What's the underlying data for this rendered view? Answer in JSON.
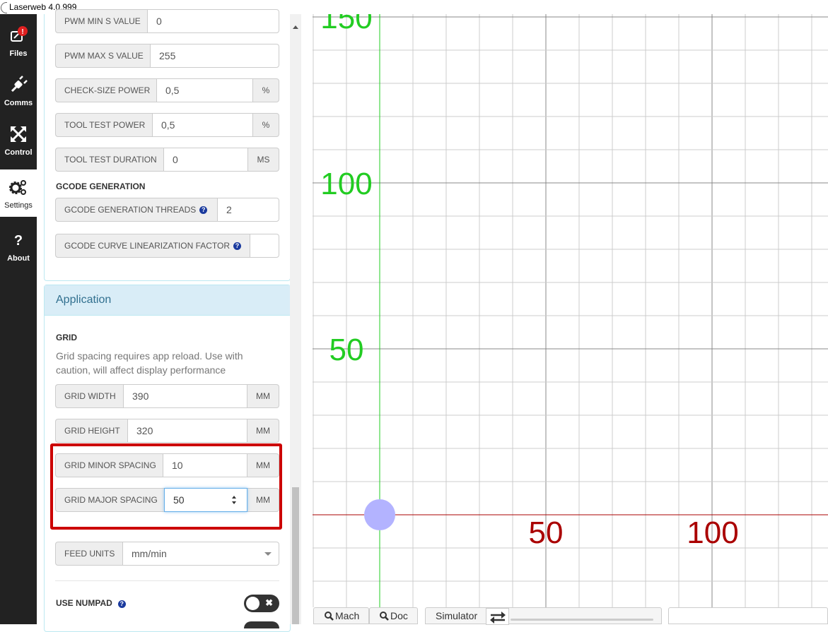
{
  "window": {
    "title": "Laserweb 4.0.999"
  },
  "sidebar": {
    "tabs": [
      {
        "label": "Files",
        "icon": "files-icon",
        "alert": true
      },
      {
        "label": "Comms",
        "icon": "plug-icon"
      },
      {
        "label": "Control",
        "icon": "arrows-icon"
      },
      {
        "label": "Settings",
        "icon": "gears-icon",
        "active": true
      },
      {
        "label": "About",
        "icon": "question-icon"
      }
    ]
  },
  "settings": {
    "pwm_min": {
      "label": "PWM MIN S VALUE",
      "value": "0"
    },
    "pwm_max": {
      "label": "PWM MAX S VALUE",
      "value": "255"
    },
    "check_size": {
      "label": "CHECK-SIZE POWER",
      "value": "0,5",
      "unit": "%"
    },
    "tool_test_power": {
      "label": "TOOL TEST POWER",
      "value": "0,5",
      "unit": "%"
    },
    "tool_test_duration": {
      "label": "TOOL TEST DURATION",
      "value": "0",
      "unit": "MS"
    },
    "gcode_heading": "GCODE GENERATION",
    "gcode_threads": {
      "label": "GCODE GENERATION THREADS",
      "value": "2"
    },
    "gcode_curve": {
      "label": "GCODE CURVE LINEARIZATION FACTOR",
      "value": ""
    }
  },
  "application": {
    "title": "Application",
    "grid_heading": "GRID",
    "grid_note": "Grid spacing requires app reload. Use with caution, will affect display performance",
    "grid_width": {
      "label": "GRID WIDTH",
      "value": "390",
      "unit": "MM"
    },
    "grid_height": {
      "label": "GRID HEIGHT",
      "value": "320",
      "unit": "MM"
    },
    "grid_minor": {
      "label": "GRID MINOR SPACING",
      "value": "10",
      "unit": "MM"
    },
    "grid_major": {
      "label": "GRID MAJOR SPACING",
      "value": "50",
      "unit": "MM"
    },
    "feed_units": {
      "label": "FEED UNITS",
      "value": "mm/min"
    },
    "use_numpad": {
      "label": "USE NUMPAD",
      "enabled": false
    }
  },
  "canvas": {
    "y_labels": [
      "150",
      "100",
      "50"
    ],
    "x_labels": [
      "50",
      "100"
    ],
    "colors": {
      "y_axis": "#22cc22",
      "x_axis": "#aa0000",
      "grid": "#cccccc",
      "major": "#888888",
      "origin": "#b3b3ff"
    }
  },
  "toolbar": {
    "mach": "Mach",
    "doc": "Doc",
    "simulator": "Simulator"
  }
}
